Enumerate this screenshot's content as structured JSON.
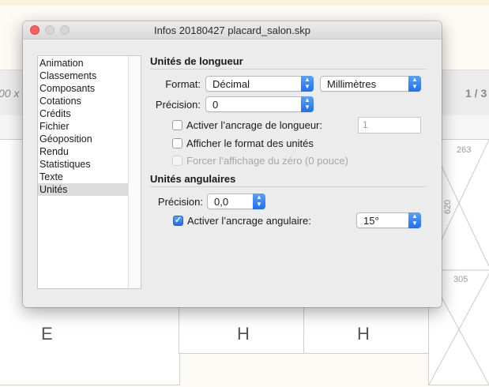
{
  "background": {
    "toolbar_left_text": "00 x",
    "toolbar_right_text": "1 / 3",
    "canvas_numbers": [
      "263",
      "620",
      "305"
    ],
    "bottom_letters": [
      "E",
      "H",
      "H"
    ]
  },
  "dialog": {
    "title": "Infos 20180427 placard_salon.skp",
    "sidebar": {
      "items": [
        {
          "label": "Animation"
        },
        {
          "label": "Classements"
        },
        {
          "label": "Composants"
        },
        {
          "label": "Cotations"
        },
        {
          "label": "Crédits"
        },
        {
          "label": "Fichier"
        },
        {
          "label": "Géoposition"
        },
        {
          "label": "Rendu"
        },
        {
          "label": "Statistiques"
        },
        {
          "label": "Texte"
        },
        {
          "label": "Unités"
        }
      ],
      "selected": "Unités"
    },
    "length_units": {
      "title": "Unités de longueur",
      "format_label": "Format:",
      "format_value": "Décimal",
      "unit_value": "Millimètres",
      "precision_label": "Précision:",
      "precision_value": "0",
      "snap_label": "Activer l’ancrage de longueur:",
      "snap_checked": false,
      "snap_value": "1",
      "display_format_label": "Afficher le format des unités",
      "display_format_checked": false,
      "force_zero_label": "Forcer l’affichage du zéro (0 pouce)",
      "force_zero_checked": false
    },
    "angle_units": {
      "title": "Unités angulaires",
      "precision_label": "Précision:",
      "precision_value": "0,0",
      "snap_label": "Activer l’ancrage angulaire:",
      "snap_checked": true,
      "snap_value": "15°"
    }
  },
  "colors": {
    "accent": "#1d6ff0",
    "close_button": "#fc605c",
    "selection": "#dcdcdc"
  }
}
